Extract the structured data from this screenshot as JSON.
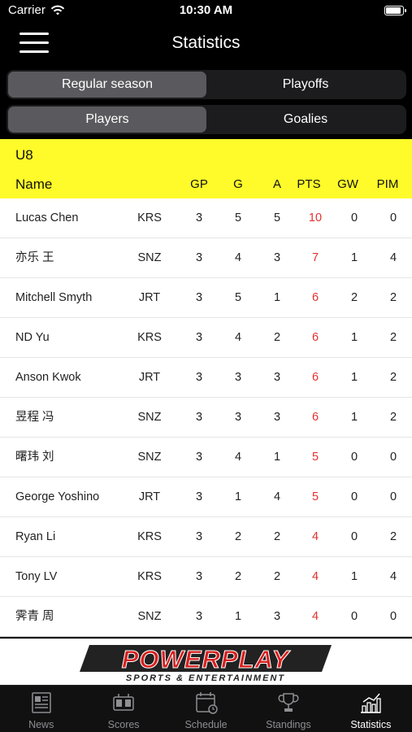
{
  "status_bar": {
    "carrier": "Carrier",
    "time": "10:30 AM",
    "battery_level": 0.95
  },
  "nav": {
    "title": "Statistics"
  },
  "season_toggle": {
    "options": [
      "Regular season",
      "Playoffs"
    ],
    "selected": 0
  },
  "type_toggle": {
    "options": [
      "Players",
      "Goalies"
    ],
    "selected": 0
  },
  "table": {
    "group": "U8",
    "columns": {
      "name": "Name",
      "gp": "GP",
      "g": "G",
      "a": "A",
      "pts": "PTS",
      "gw": "GW",
      "pim": "PIM"
    },
    "rows": [
      {
        "name": "Lucas Chen",
        "team": "KRS",
        "gp": "3",
        "g": "5",
        "a": "5",
        "pts": "10",
        "gw": "0",
        "pim": "0"
      },
      {
        "name": "亦乐 王",
        "team": "SNZ",
        "gp": "3",
        "g": "4",
        "a": "3",
        "pts": "7",
        "gw": "1",
        "pim": "4"
      },
      {
        "name": "Mitchell Smyth",
        "team": "JRT",
        "gp": "3",
        "g": "5",
        "a": "1",
        "pts": "6",
        "gw": "2",
        "pim": "2"
      },
      {
        "name": "ND Yu",
        "team": "KRS",
        "gp": "3",
        "g": "4",
        "a": "2",
        "pts": "6",
        "gw": "1",
        "pim": "2"
      },
      {
        "name": "Anson Kwok",
        "team": "JRT",
        "gp": "3",
        "g": "3",
        "a": "3",
        "pts": "6",
        "gw": "1",
        "pim": "2"
      },
      {
        "name": "昱程 冯",
        "team": "SNZ",
        "gp": "3",
        "g": "3",
        "a": "3",
        "pts": "6",
        "gw": "1",
        "pim": "2"
      },
      {
        "name": "曙玮 刘",
        "team": "SNZ",
        "gp": "3",
        "g": "4",
        "a": "1",
        "pts": "5",
        "gw": "0",
        "pim": "0"
      },
      {
        "name": "George Yoshino",
        "team": "JRT",
        "gp": "3",
        "g": "1",
        "a": "4",
        "pts": "5",
        "gw": "0",
        "pim": "0"
      },
      {
        "name": "Ryan Li",
        "team": "KRS",
        "gp": "3",
        "g": "2",
        "a": "2",
        "pts": "4",
        "gw": "0",
        "pim": "2"
      },
      {
        "name": "Tony LV",
        "team": "KRS",
        "gp": "3",
        "g": "2",
        "a": "2",
        "pts": "4",
        "gw": "1",
        "pim": "4"
      },
      {
        "name": "霁青 周",
        "team": "SNZ",
        "gp": "3",
        "g": "1",
        "a": "3",
        "pts": "4",
        "gw": "0",
        "pim": "0"
      }
    ]
  },
  "banner": {
    "brand": "POWERPLAY",
    "tagline": "SPORTS & ENTERTAINMENT"
  },
  "tab_bar": {
    "tabs": [
      {
        "label": "News",
        "icon": "newspaper-icon"
      },
      {
        "label": "Scores",
        "icon": "scoreboard-icon"
      },
      {
        "label": "Schedule",
        "icon": "calendar-icon"
      },
      {
        "label": "Standings",
        "icon": "trophy-icon"
      },
      {
        "label": "Statistics",
        "icon": "chart-icon"
      }
    ],
    "selected": 4
  },
  "colors": {
    "header_bg": "#fffb2a",
    "points": "#e53030",
    "active_segment": "#5a5a5e",
    "segment_bg": "#1c1c1e",
    "logo_red": "#d81e1e"
  }
}
